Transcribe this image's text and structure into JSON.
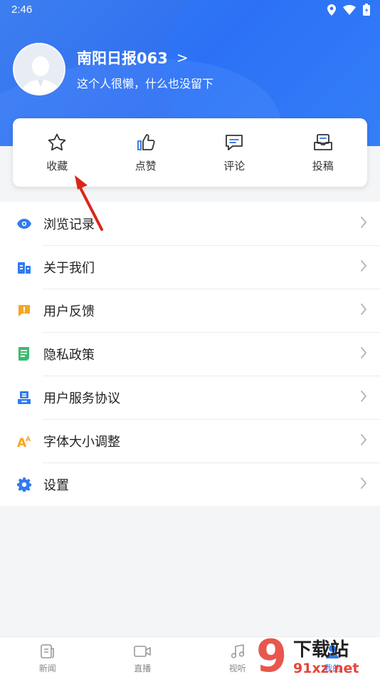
{
  "status_bar": {
    "time": "2:46",
    "icons": [
      "location-icon",
      "wifi-icon",
      "battery-charging-icon"
    ]
  },
  "profile": {
    "username": "南阳日报063",
    "signature": "这个人很懒，什么也没留下",
    "chevron": ">"
  },
  "actions": [
    {
      "label": "收藏",
      "icon": "star-icon"
    },
    {
      "label": "点赞",
      "icon": "thumbs-up-icon"
    },
    {
      "label": "评论",
      "icon": "comment-icon"
    },
    {
      "label": "投稿",
      "icon": "submit-icon"
    }
  ],
  "menu": [
    {
      "label": "浏览记录",
      "icon": "eye-icon",
      "color": "#2f7bf0"
    },
    {
      "label": "关于我们",
      "icon": "building-icon",
      "color": "#2f7bf0"
    },
    {
      "label": "用户反馈",
      "icon": "feedback-icon",
      "color": "#f5a623"
    },
    {
      "label": "隐私政策",
      "icon": "document-icon",
      "color": "#3dba6f"
    },
    {
      "label": "用户服务协议",
      "icon": "agreement-icon",
      "color": "#2f7bf0"
    },
    {
      "label": "字体大小调整",
      "icon": "font-size-icon",
      "color": "#f5a623"
    },
    {
      "label": "设置",
      "icon": "gear-icon",
      "color": "#2f7bf0"
    }
  ],
  "bottom_nav": [
    {
      "label": "新闻",
      "icon": "news-icon"
    },
    {
      "label": "直播",
      "icon": "video-icon"
    },
    {
      "label": "视听",
      "icon": "music-icon"
    },
    {
      "label": "我的",
      "icon": "user-icon"
    }
  ],
  "watermark": {
    "text": "下载站",
    "url_text": "91xz.net",
    "logo_number": "9"
  },
  "colors": {
    "header_blue": "#3478f0",
    "accent_blue": "#2f7bf0",
    "annotation_red": "#d9261c"
  }
}
